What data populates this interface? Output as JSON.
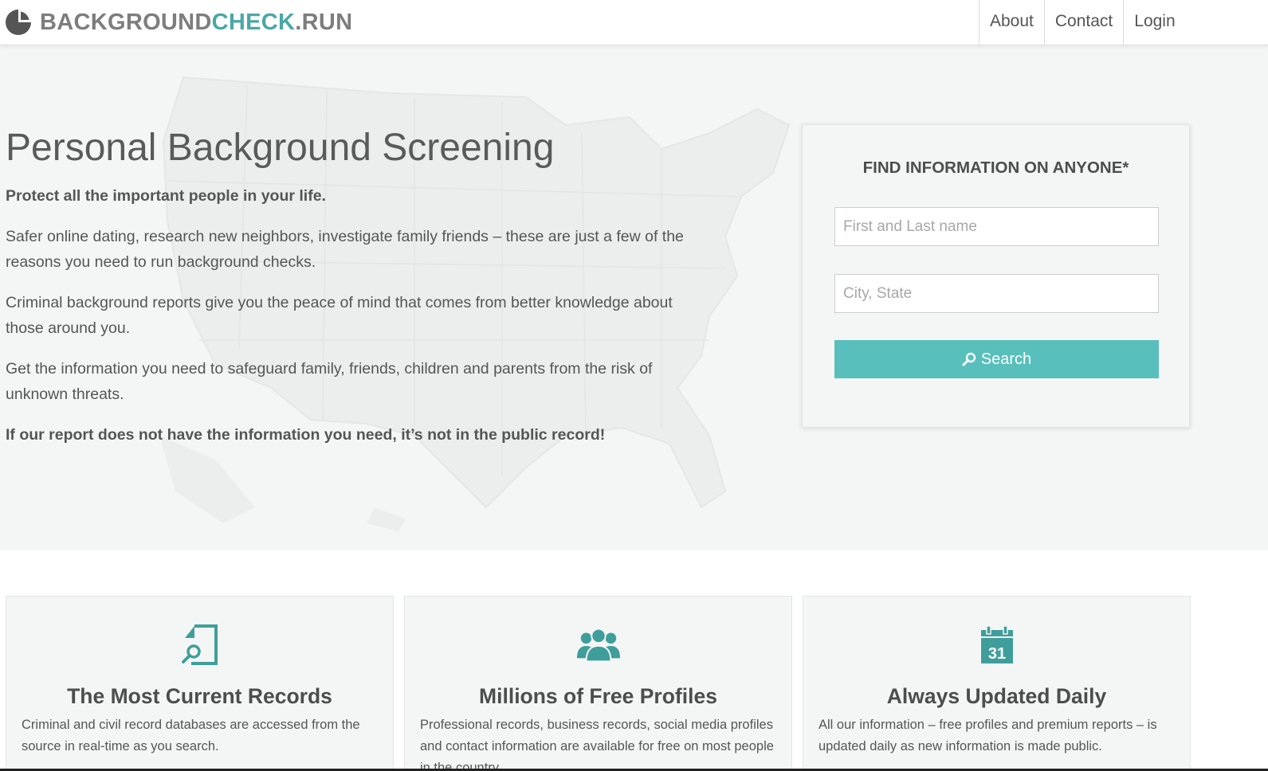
{
  "brand": {
    "part1": "BACKGROUND",
    "part2": "CHECK",
    "part3": ".RUN",
    "logo_icon": "pie-chart-logo-icon"
  },
  "nav": {
    "items": [
      {
        "label": "About"
      },
      {
        "label": "Contact"
      },
      {
        "label": "Login"
      }
    ]
  },
  "hero": {
    "title": "Personal Background Screening",
    "lead": "Protect all the important people in your life.",
    "paragraphs": [
      "Safer online dating, research new neighbors, investigate family friends – these are just a few of the reasons you need to run background checks.",
      "Criminal background reports give you the peace of mind that comes from better knowledge about those around you.",
      "Get the information you need to safeguard family, friends, children and parents from the risk of unknown threats."
    ],
    "closing": "If our report does not have the information you need, it’s not in the public record!"
  },
  "search": {
    "title": "FIND INFORMATION ON ANYONE*",
    "name_placeholder": "First and Last name",
    "name_value": "",
    "location_placeholder": "City, State",
    "location_value": "",
    "button_label": "Search",
    "button_icon": "search-icon"
  },
  "features": [
    {
      "icon": "document-search-icon",
      "title": "The Most Current Records",
      "text": "Criminal and civil record databases are accessed from the source in real-time as you search."
    },
    {
      "icon": "users-group-icon",
      "title": "Millions of Free Profiles",
      "text": "Professional records, business records, social media profiles and contact information are available for free on most people in the country."
    },
    {
      "icon": "calendar-icon",
      "calendar_day": "31",
      "title": "Always Updated Daily",
      "text": "All our information – free profiles and premium reports – is updated daily as new information is made public."
    }
  ],
  "colors": {
    "accent": "#58bfbc",
    "brand_teal": "#4aa8a6",
    "brand_gray": "#7d7d7d",
    "hero_bg": "#f4f6f6",
    "text": "#555555"
  }
}
